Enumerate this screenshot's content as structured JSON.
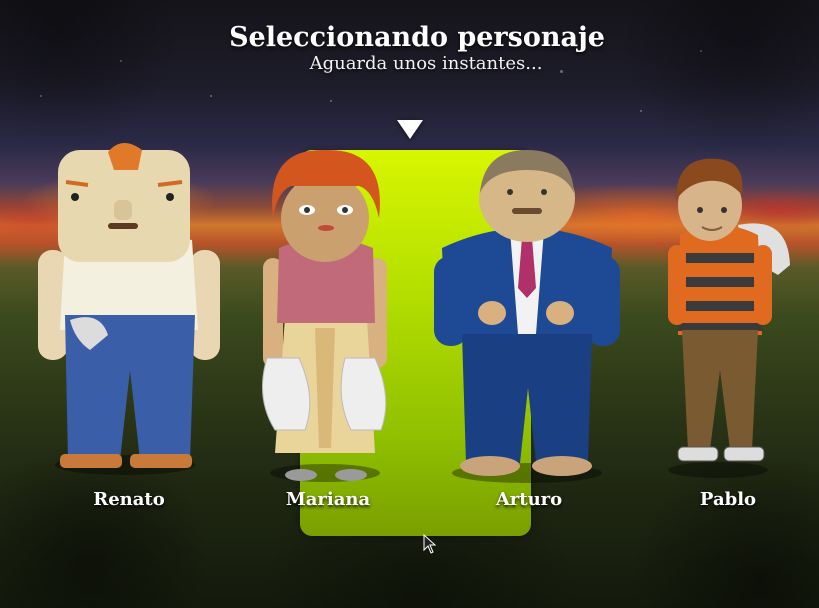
{
  "header": {
    "title": "Seleccionando personaje",
    "subtitle": "Aguarda unos instantes..."
  },
  "selection": {
    "selected_index": 1,
    "indicator_icon": "down-triangle-icon",
    "highlight_color": "#c4ec00"
  },
  "characters": [
    {
      "name": "Renato"
    },
    {
      "name": "Mariana"
    },
    {
      "name": "Arturo"
    },
    {
      "name": "Pablo"
    }
  ],
  "cursor_icon": "mouse-pointer-icon"
}
